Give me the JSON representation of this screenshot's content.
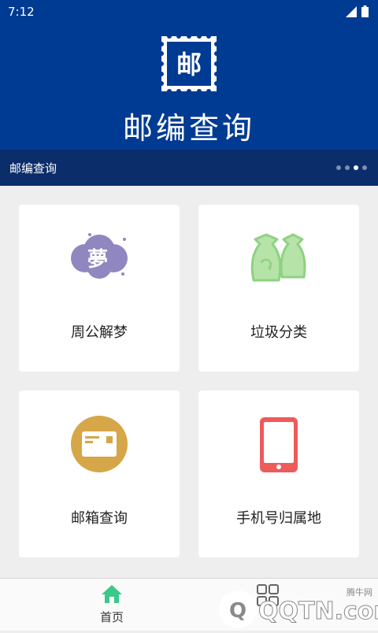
{
  "status_bar": {
    "time": "7:12"
  },
  "header": {
    "stamp_char": "邮",
    "title": "邮编查询"
  },
  "subheader": {
    "label": "邮编查询"
  },
  "cards": [
    {
      "label": "周公解梦",
      "icon": "dream-cloud-icon",
      "color": "#9187c0"
    },
    {
      "label": "垃圾分类",
      "icon": "garbage-bag-icon",
      "color": "#8ed281"
    },
    {
      "label": "邮箱查询",
      "icon": "mail-envelope-icon",
      "color": "#d5a748"
    },
    {
      "label": "手机号归属地",
      "icon": "mobile-phone-icon",
      "color": "#ee5b5b"
    }
  ],
  "dream_icon_char": "夢",
  "bottom_nav": {
    "home_label": "首页"
  },
  "watermark": {
    "text": "QQTN.com",
    "small": "腾牛网"
  },
  "colors": {
    "primary": "#003b93",
    "subbar": "#0b2e6b",
    "home_active": "#3cc88a"
  }
}
